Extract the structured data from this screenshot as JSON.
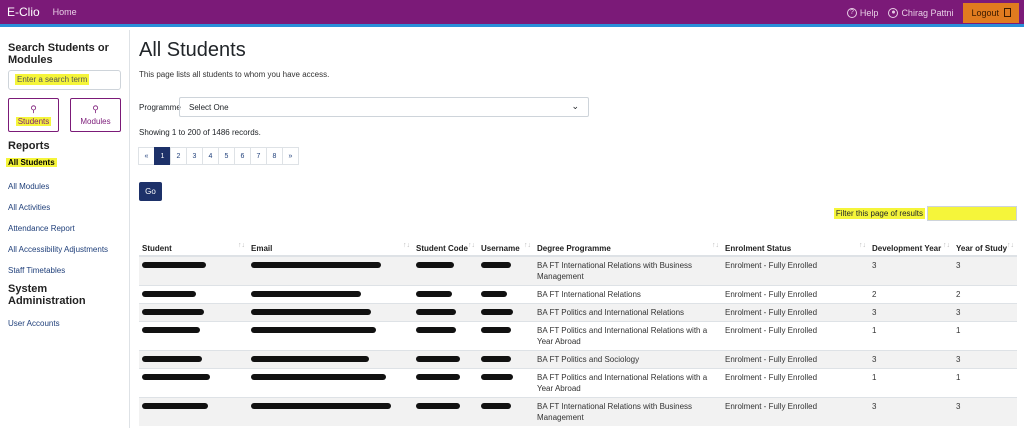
{
  "topbar": {
    "brand": "E-Clio",
    "home": "Home",
    "help": "Help",
    "user": "Chirag Pattni",
    "logout": "Logout",
    "colors": {
      "bar": "#7b1a78",
      "accent_line": "#2a8fd8",
      "logout_bg": "#e07b1f"
    }
  },
  "sidebar": {
    "search_title": "Search Students or Modules",
    "search_placeholder": "Enter a search term",
    "btn_students": "Students",
    "btn_modules": "Modules",
    "reports_title": "Reports",
    "reports": [
      "All Students",
      "All Modules",
      "All Activities",
      "Attendance Report",
      "All Accessibility Adjustments",
      "Staff Timetables"
    ],
    "admin_title": "System Administration",
    "admin": [
      "User Accounts"
    ]
  },
  "main": {
    "title": "All Students",
    "description": "This page lists all students to whom you have access.",
    "programme_label": "Programme",
    "programme_value": "Select One",
    "records": "Showing 1 to 200 of 1486 records.",
    "pages": [
      "«",
      "1",
      "2",
      "3",
      "4",
      "5",
      "6",
      "7",
      "8",
      "»"
    ],
    "active_page": "1",
    "go": "Go",
    "filter_label": "Filter this page of results",
    "columns": [
      "Student",
      "Email",
      "Student Code",
      "Username",
      "Degree Programme",
      "Enrolment Status",
      "Development Year",
      "Year of Study"
    ],
    "rows": [
      {
        "programme": "BA FT International Relations with Business Management",
        "status": "Enrolment - Fully Enrolled",
        "dev_year": "3",
        "year": "3"
      },
      {
        "programme": "BA FT International Relations",
        "status": "Enrolment - Fully Enrolled",
        "dev_year": "2",
        "year": "2"
      },
      {
        "programme": "BA FT Politics and International Relations",
        "status": "Enrolment - Fully Enrolled",
        "dev_year": "3",
        "year": "3"
      },
      {
        "programme": "BA FT Politics and International Relations with a Year Abroad",
        "status": "Enrolment - Fully Enrolled",
        "dev_year": "1",
        "year": "1"
      },
      {
        "programme": "BA FT Politics and Sociology",
        "status": "Enrolment - Fully Enrolled",
        "dev_year": "3",
        "year": "3"
      },
      {
        "programme": "BA FT Politics and International Relations with a Year Abroad",
        "status": "Enrolment - Fully Enrolled",
        "dev_year": "1",
        "year": "1"
      },
      {
        "programme": "BA FT International Relations with Business Management",
        "status": "Enrolment - Fully Enrolled",
        "dev_year": "3",
        "year": "3"
      }
    ]
  }
}
